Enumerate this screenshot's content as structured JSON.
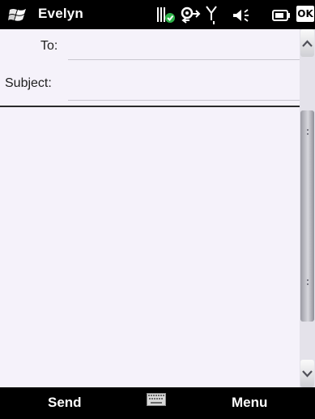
{
  "title_bar": {
    "app_title": "Evelyn",
    "ok_label": "OK",
    "icons": [
      "windows-start-icon",
      "sync-status-icon",
      "connectivity-icon",
      "signal-icon",
      "volume-icon",
      "battery-icon"
    ]
  },
  "compose": {
    "to_label": "To:",
    "to_value": "",
    "subject_label": "Subject:",
    "subject_value": "",
    "body_text": ""
  },
  "scrollbar": {
    "icons": [
      "scroll-up-arrow-icon",
      "scroll-down-arrow-icon"
    ]
  },
  "soft_keys": {
    "left": "Send",
    "center_icon": "keyboard-icon",
    "right": "Menu"
  },
  "colors": {
    "bar_background": "#000000",
    "content_background": "#f5f2fa",
    "label_text": "#202020"
  }
}
